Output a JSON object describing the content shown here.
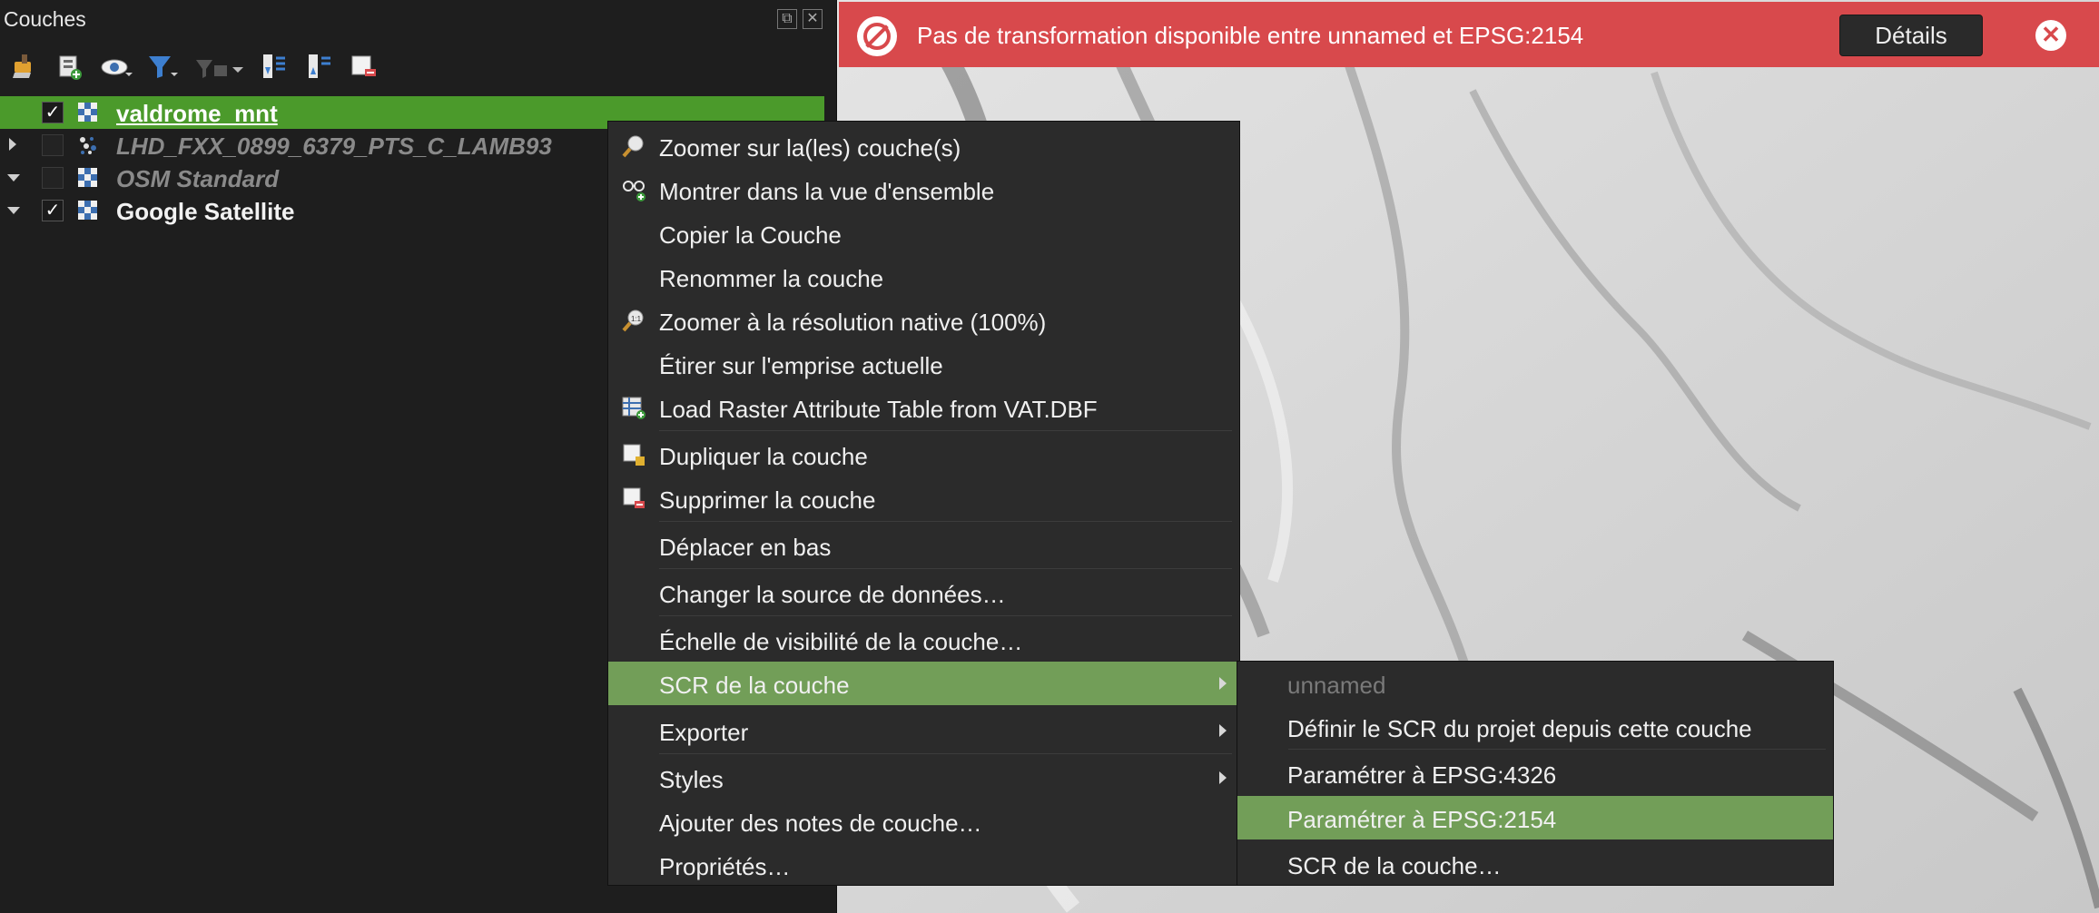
{
  "panel": {
    "title": "Couches",
    "float_btn": "⧉",
    "close_btn": "✕"
  },
  "toolbar": {
    "icons": [
      "style-brush-icon",
      "add-group-icon",
      "visibility-eye-icon",
      "filter-icon",
      "filter-legend-icon",
      "expand-all-icon",
      "collapse-all-icon",
      "remove-layer-icon"
    ]
  },
  "layers": [
    {
      "name": "valdrome_mnt",
      "checked": true,
      "selected": true,
      "icon": "raster-icon"
    },
    {
      "name": "LHD_FXX_0899_6379_PTS_C_LAMB93",
      "checked": false,
      "icon": "point-cloud-icon"
    },
    {
      "name": "OSM Standard",
      "checked": false,
      "icon": "raster-icon"
    },
    {
      "name": "Google Satellite",
      "checked": true,
      "icon": "raster-icon"
    }
  ],
  "check_mark": "✓",
  "message_bar": {
    "text": "Pas de transformation disponible entre unnamed et EPSG:2154",
    "details_label": "Détails",
    "close_label": "✕",
    "color": "#d8494c"
  },
  "context_menu": {
    "items": [
      {
        "label": "Zoomer sur la(les) couche(s)",
        "icon": "zoom-layer-icon"
      },
      {
        "label": "Montrer dans la vue d'ensemble",
        "icon": "overview-glasses-icon"
      },
      {
        "label": "Copier la Couche"
      },
      {
        "label": "Renommer la couche"
      },
      {
        "label": "Zoomer à la résolution native (100%)",
        "icon": "zoom-native-icon"
      },
      {
        "label": "Étirer sur l'emprise actuelle"
      },
      {
        "label": "Load Raster Attribute Table from VAT.DBF",
        "icon": "attribute-table-icon"
      },
      {
        "label": "Dupliquer la couche",
        "icon": "duplicate-layer-icon"
      },
      {
        "label": "Supprimer la couche",
        "icon": "remove-layer-icon"
      },
      {
        "label": "Déplacer en bas"
      },
      {
        "label": "Changer la source de données…"
      },
      {
        "label": "Échelle de visibilité de la couche…"
      },
      {
        "label": "SCR de la couche",
        "submenu": true,
        "highlight": true
      },
      {
        "label": "Exporter",
        "submenu": true
      },
      {
        "label": "Styles",
        "submenu": true
      },
      {
        "label": "Ajouter des notes de couche…"
      },
      {
        "label": "Propriétés…"
      }
    ]
  },
  "submenu": {
    "items": [
      {
        "label": "unnamed",
        "disabled": true
      },
      {
        "label": "Définir le SCR du projet depuis cette couche"
      },
      {
        "label": "Paramétrer à EPSG:4326"
      },
      {
        "label": "Paramétrer à EPSG:2154",
        "highlight": true
      },
      {
        "label": "SCR de la couche…"
      }
    ]
  },
  "colors": {
    "selection_green": "#4b9a2b",
    "menu_highlight": "#729e58",
    "panel_bg": "#1e1e1e"
  }
}
